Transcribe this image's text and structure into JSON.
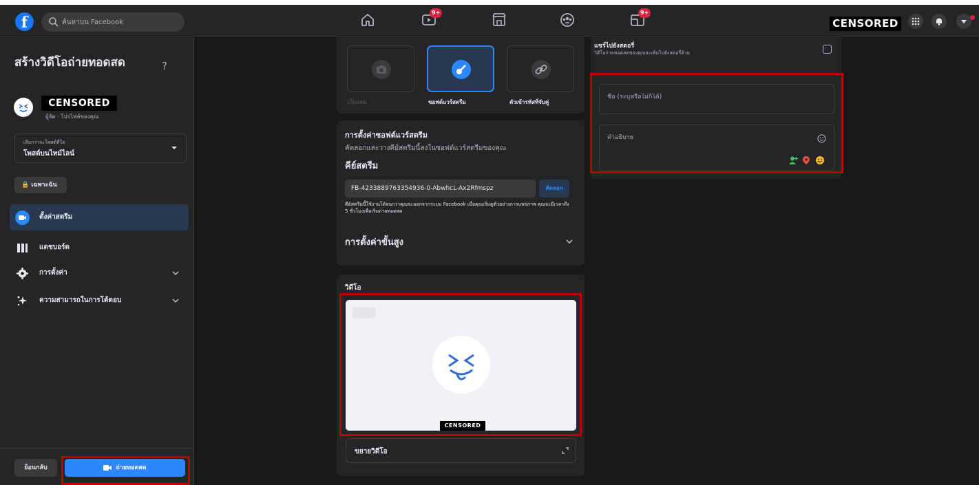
{
  "topbar": {
    "logo": "f",
    "search_placeholder": "ค้นหาบน Facebook",
    "nav": [
      {
        "icon": "home-icon"
      },
      {
        "icon": "video-icon",
        "badge": "9+"
      },
      {
        "icon": "marketplace-icon"
      },
      {
        "icon": "groups-icon"
      },
      {
        "icon": "gaming-icon",
        "badge": "9+"
      }
    ],
    "profile_name": "CENSORED",
    "right_icons": [
      "menu-grid-icon",
      "notifications-icon",
      "account-dropdown-icon"
    ]
  },
  "sidebar": {
    "title": "สร้างวิดีโอถ่ายทอดสด",
    "help": "?",
    "owner_name": "CENSORED",
    "owner_role": "ผู้จัด · โปรไฟล์ของคุณ",
    "post_location": {
      "label": "เลือกว่าจะโพสต์ที่ใด",
      "value": "โพสต์บนไทม์ไลน์"
    },
    "privacy": "เฉพาะฉัน",
    "menu": [
      {
        "label": "ตั้งค่าสตรีม",
        "icon": "stream-setup-icon",
        "active": true
      },
      {
        "label": "แดชบอร์ด",
        "icon": "dashboard-icon",
        "active": false
      },
      {
        "label": "การตั้งค่า",
        "icon": "settings-icon",
        "active": false,
        "expandable": true
      },
      {
        "label": "ความสามารถในการโต้ตอบ",
        "icon": "interactivity-icon",
        "active": false,
        "expandable": true
      }
    ],
    "back_label": "ย้อนกลับ",
    "go_live_label": "ถ่ายทอดสด"
  },
  "source": {
    "options": [
      {
        "label": "เว็บแคม",
        "icon": "camera-icon",
        "selected": false
      },
      {
        "label": "ซอฟต์แวร์สตรีม",
        "icon": "streaming-software-icon",
        "selected": true
      },
      {
        "label": "ตัวเข้ารหัสที่จับคู่",
        "icon": "link-icon",
        "selected": false
      }
    ]
  },
  "stream_setup": {
    "title": "การตั้งค่าซอฟต์แวร์สตรีม",
    "subtitle": "คัดลอกและวางคีย์สตรีมนี้ลงในซอฟต์แวร์สตรีมของคุณ",
    "key_heading": "คีย์สตรีม",
    "key_value": "FB-4233889763354936-0-AbwhcL-Ax2Rfmspz",
    "copy_label": "คัดลอก",
    "key_note": "คีย์สตรีมนี้ใช้งานได้จนกว่าคุณจะออกจากระบบ Facebook เมื่อคุณเริ่มดูตัวอย่างการแพร่ภาพ คุณจะมีเวลาถึง 5 ชั่วโมงเพื่อเริ่มถ่ายทอดสด",
    "advanced_label": "การตั้งค่าขั้นสูง"
  },
  "video": {
    "title": "วิดีโอ",
    "preview_caption": "CENSORED",
    "expand_label": "ขยายวิดีโอ"
  },
  "post_details": {
    "story_title": "แชร์ไปยังสตอรี่",
    "story_sub": "วิดีโอถ่ายทอดสดของคุณจะเพิ่มไปยังสตอรี่ด้วย",
    "title_placeholder": "ชื่อ (ระบุหรือไม่ก็ได้)",
    "description_placeholder": "คำอธิบาย",
    "tools": [
      "tag-people-icon",
      "location-icon",
      "feeling-icon"
    ]
  },
  "colors": {
    "accent": "#2d88ff",
    "highlight": "#c00000",
    "background": "#18191a",
    "surface": "#242526"
  }
}
